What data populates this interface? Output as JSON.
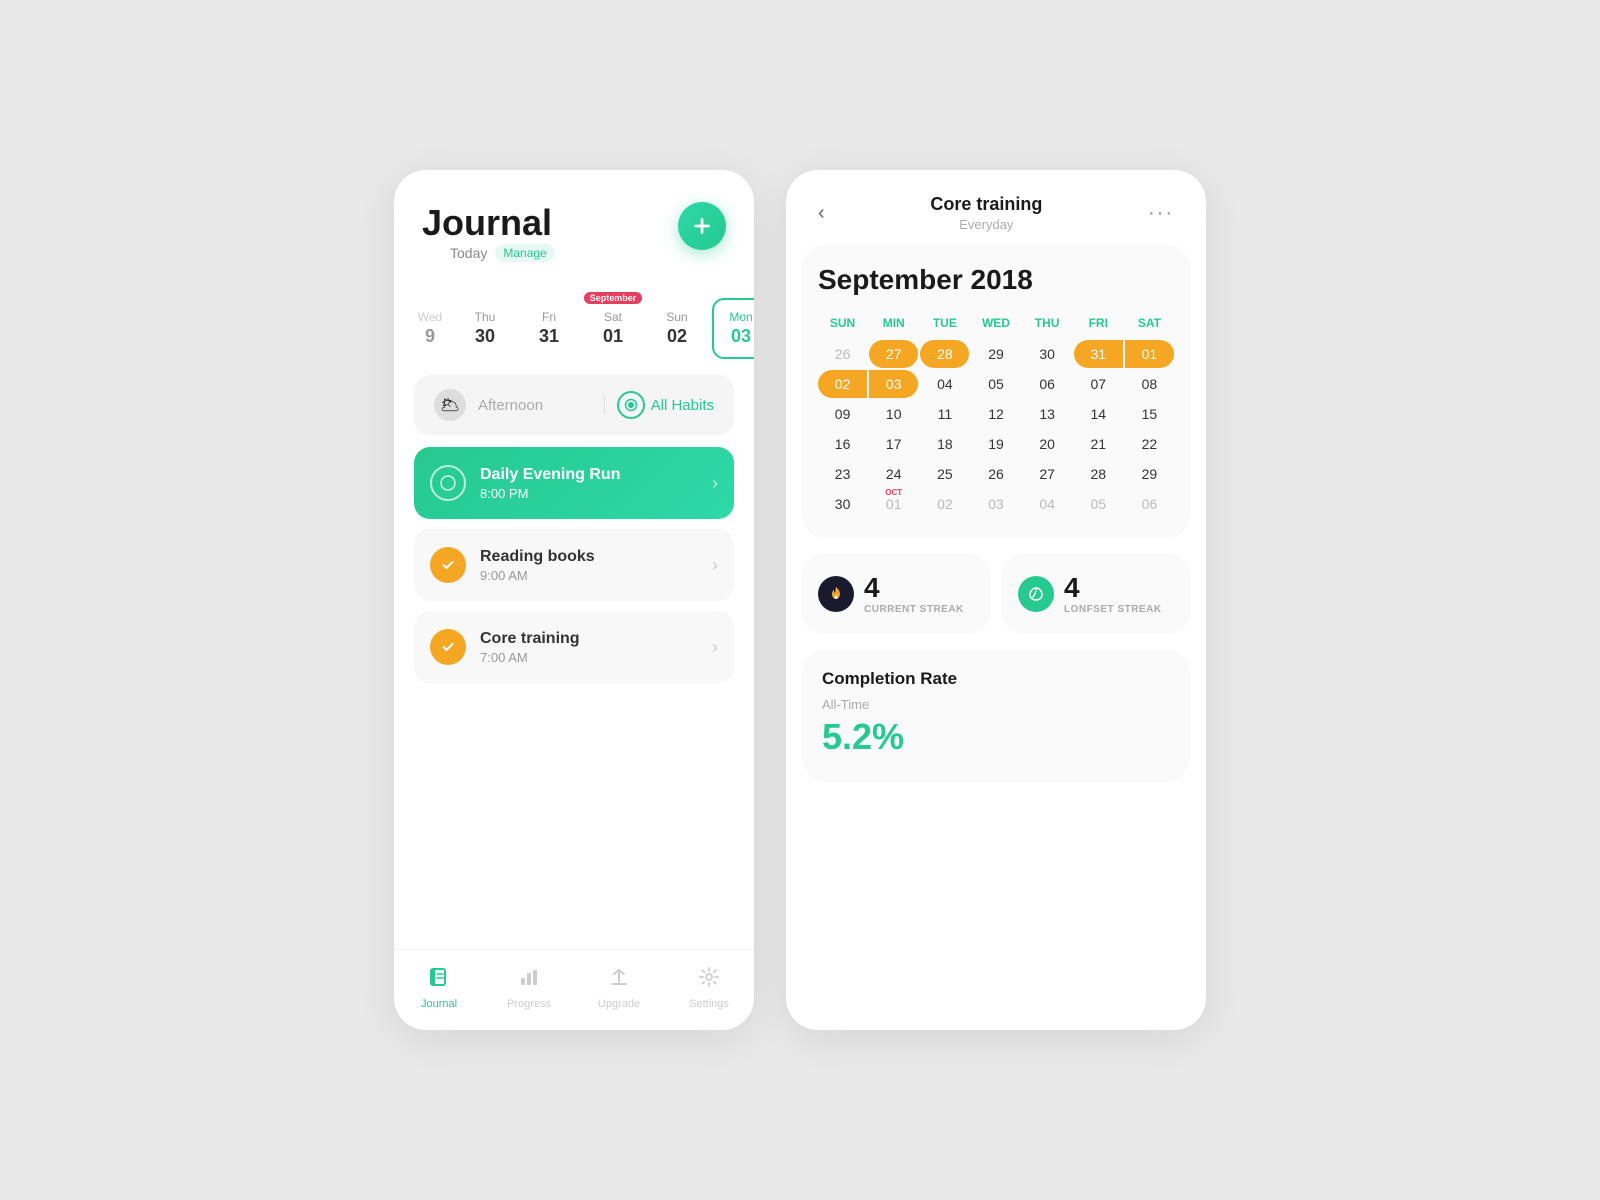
{
  "left": {
    "title": "Journal",
    "today_label": "Today",
    "manage_label": "Manage",
    "add_button_label": "+",
    "dates": [
      {
        "day": "Wed",
        "num": "9",
        "active": false,
        "badge": null,
        "partial": true
      },
      {
        "day": "Thu",
        "num": "30",
        "active": false,
        "badge": null
      },
      {
        "day": "Fri",
        "num": "31",
        "active": false,
        "badge": null
      },
      {
        "day": "Sat",
        "num": "01",
        "active": false,
        "badge": "September"
      },
      {
        "day": "Sun",
        "num": "02",
        "active": false,
        "badge": null
      },
      {
        "day": "Mon",
        "num": "03",
        "active": true,
        "badge": null
      }
    ],
    "filter": {
      "icon": "🌥",
      "label": "Afternoon",
      "all_habits_label": "All Habits"
    },
    "habits": [
      {
        "name": "Daily Evening Run",
        "time": "8:00 PM",
        "type": "green",
        "checked": false
      },
      {
        "name": "Reading books",
        "time": "9:00 AM",
        "type": "normal",
        "checked": true
      },
      {
        "name": "Core training",
        "time": "7:00 AM",
        "type": "normal",
        "checked": true
      }
    ],
    "nav": [
      {
        "icon": "📓",
        "label": "Journal",
        "active": true
      },
      {
        "icon": "📊",
        "label": "Progress",
        "active": false
      },
      {
        "icon": "⬆",
        "label": "Upgrade",
        "active": false
      },
      {
        "icon": "⚙",
        "label": "Settings",
        "active": false
      }
    ]
  },
  "right": {
    "title": "Core training",
    "subtitle": "Everyday",
    "back_label": "‹",
    "more_label": "···",
    "month_label": "September 2018",
    "cal_headers": [
      {
        "label": "SUN",
        "type": "green"
      },
      {
        "label": "MIN",
        "type": "green"
      },
      {
        "label": "TUE",
        "type": "green"
      },
      {
        "label": "WED",
        "type": "green"
      },
      {
        "label": "THU",
        "type": "green"
      },
      {
        "label": "FRI",
        "type": "green"
      },
      {
        "label": "SAT",
        "type": "green"
      }
    ],
    "cal_rows": [
      [
        {
          "num": "26",
          "type": "other-month"
        },
        {
          "num": "27",
          "type": "hl-solo"
        },
        {
          "num": "28",
          "type": "hl-solo"
        },
        {
          "num": "29",
          "type": "normal"
        },
        {
          "num": "30",
          "type": "normal"
        },
        {
          "num": "31",
          "type": "hl-first"
        },
        {
          "num": "01",
          "type": "hl-last"
        }
      ],
      [
        {
          "num": "02",
          "type": "hl-first"
        },
        {
          "num": "03",
          "type": "hl-last"
        },
        {
          "num": "04",
          "type": "normal"
        },
        {
          "num": "05",
          "type": "normal"
        },
        {
          "num": "06",
          "type": "normal"
        },
        {
          "num": "07",
          "type": "normal"
        },
        {
          "num": "08",
          "type": "normal"
        }
      ],
      [
        {
          "num": "09",
          "type": "normal"
        },
        {
          "num": "10",
          "type": "normal"
        },
        {
          "num": "11",
          "type": "normal"
        },
        {
          "num": "12",
          "type": "normal"
        },
        {
          "num": "13",
          "type": "normal"
        },
        {
          "num": "14",
          "type": "normal"
        },
        {
          "num": "15",
          "type": "normal"
        }
      ],
      [
        {
          "num": "16",
          "type": "normal"
        },
        {
          "num": "17",
          "type": "normal"
        },
        {
          "num": "18",
          "type": "normal"
        },
        {
          "num": "19",
          "type": "normal"
        },
        {
          "num": "20",
          "type": "normal"
        },
        {
          "num": "21",
          "type": "normal"
        },
        {
          "num": "22",
          "type": "normal"
        }
      ],
      [
        {
          "num": "23",
          "type": "normal"
        },
        {
          "num": "24",
          "type": "normal"
        },
        {
          "num": "25",
          "type": "normal"
        },
        {
          "num": "26",
          "type": "normal"
        },
        {
          "num": "27",
          "type": "normal"
        },
        {
          "num": "28",
          "type": "normal"
        },
        {
          "num": "29",
          "type": "normal"
        }
      ],
      [
        {
          "num": "30",
          "type": "normal"
        },
        {
          "num": "01",
          "type": "oct-label"
        },
        {
          "num": "02",
          "type": "other-month"
        },
        {
          "num": "03",
          "type": "other-month"
        },
        {
          "num": "04",
          "type": "other-month"
        },
        {
          "num": "05",
          "type": "other-month"
        },
        {
          "num": "06",
          "type": "other-month"
        }
      ]
    ],
    "streaks": [
      {
        "icon": "🔥",
        "icon_type": "dark",
        "count": "4",
        "label": "CURRENT STREAK"
      },
      {
        "icon": "🌿",
        "icon_type": "green",
        "count": "4",
        "label": "LONFSET STREAK"
      }
    ],
    "completion": {
      "title": "Completion Rate",
      "sub_label": "All-Time",
      "rate": "5.2%"
    }
  }
}
